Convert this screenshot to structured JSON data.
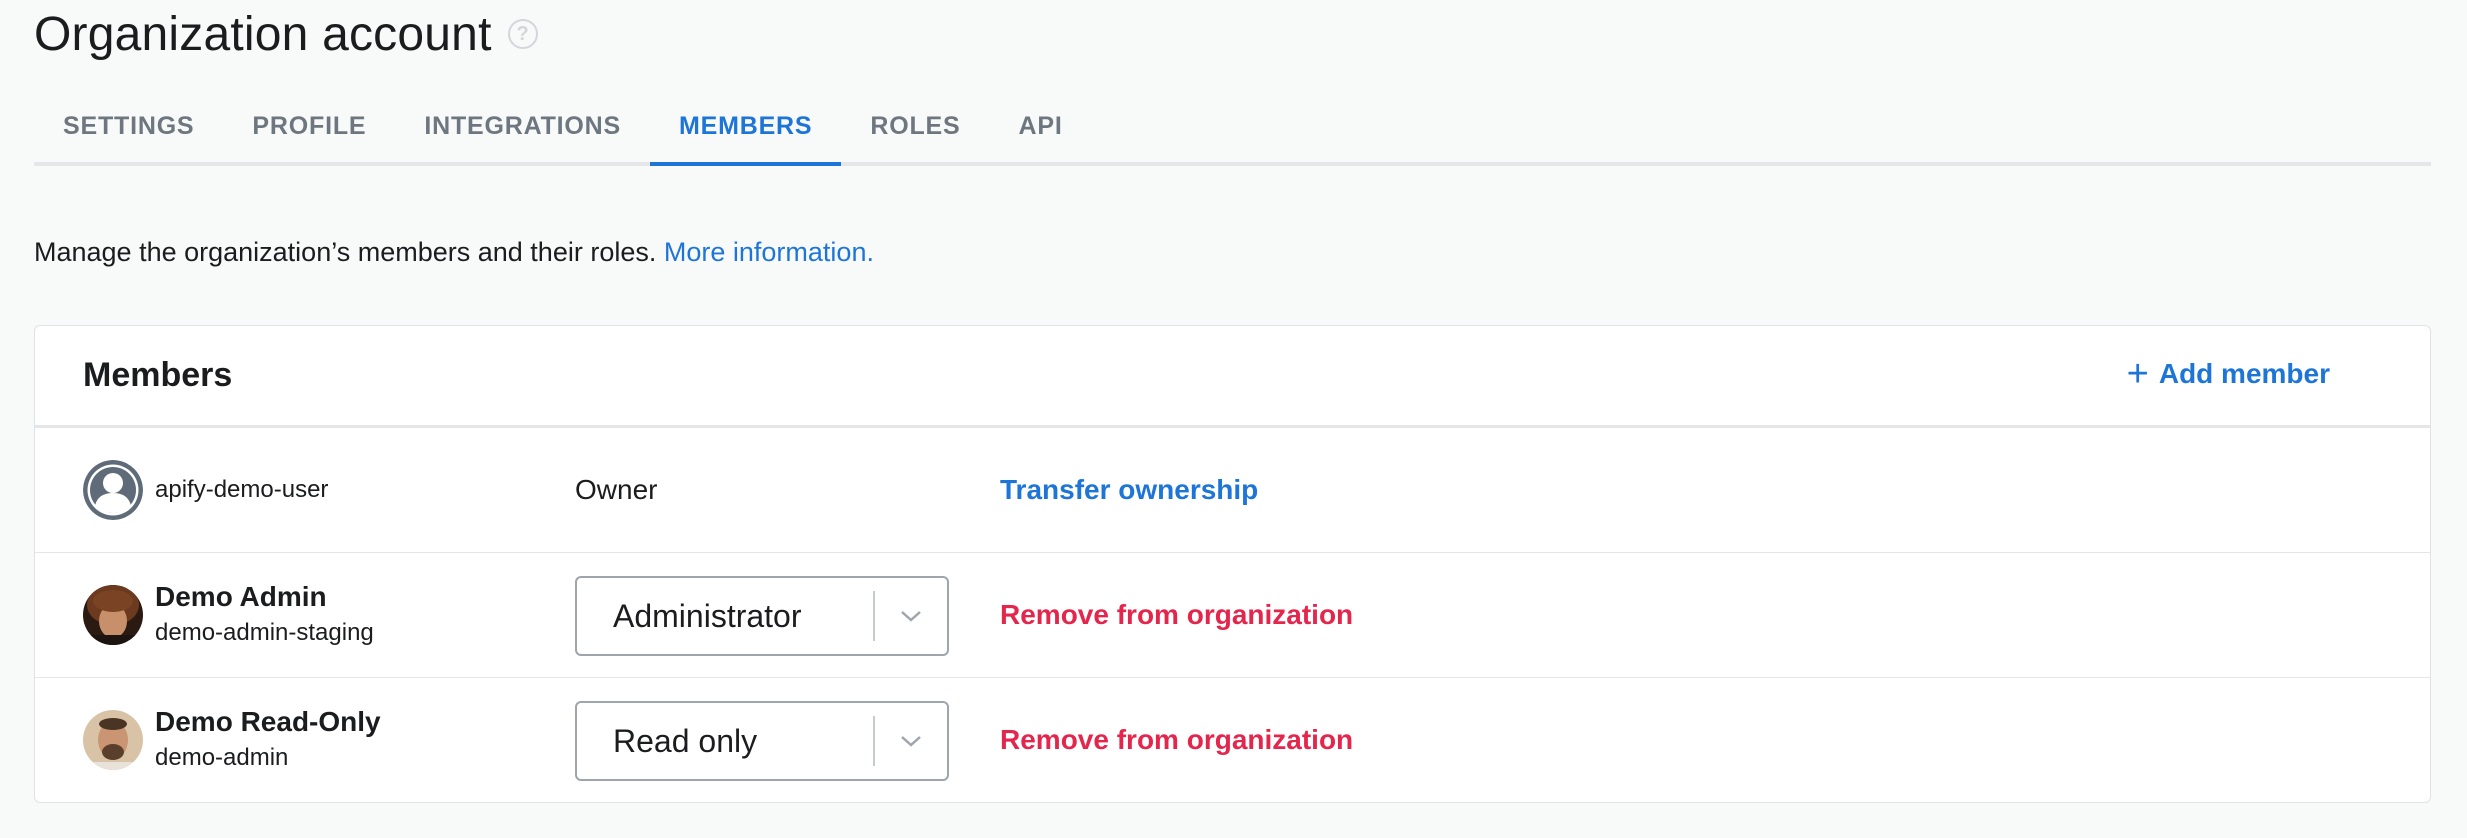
{
  "header": {
    "title": "Organization account",
    "help_icon": "?"
  },
  "tabs": [
    {
      "label": "SETTINGS",
      "active": false
    },
    {
      "label": "PROFILE",
      "active": false
    },
    {
      "label": "INTEGRATIONS",
      "active": false
    },
    {
      "label": "MEMBERS",
      "active": true
    },
    {
      "label": "ROLES",
      "active": false
    },
    {
      "label": "API",
      "active": false
    }
  ],
  "description": {
    "text": "Manage the organization’s members and their roles.",
    "link": "More information."
  },
  "members_card": {
    "title": "Members",
    "add_label": "Add member",
    "add_icon": "+",
    "rows": [
      {
        "name": "",
        "handle": "apify-demo-user",
        "role": "Owner",
        "action": "Transfer ownership",
        "avatar": "default-user-icon"
      },
      {
        "name": "Demo Admin",
        "handle": "demo-admin-staging",
        "role": "Administrator",
        "action": "Remove from organization",
        "avatar": "photo-avatar"
      },
      {
        "name": "Demo Read-Only",
        "handle": "demo-admin",
        "role": "Read only",
        "action": "Remove from organization",
        "avatar": "photo-avatar"
      }
    ]
  },
  "colors": {
    "accent": "#1e75d8",
    "danger": "#e4264d",
    "text": "#1b1c1e",
    "muted": "#6e7780"
  }
}
